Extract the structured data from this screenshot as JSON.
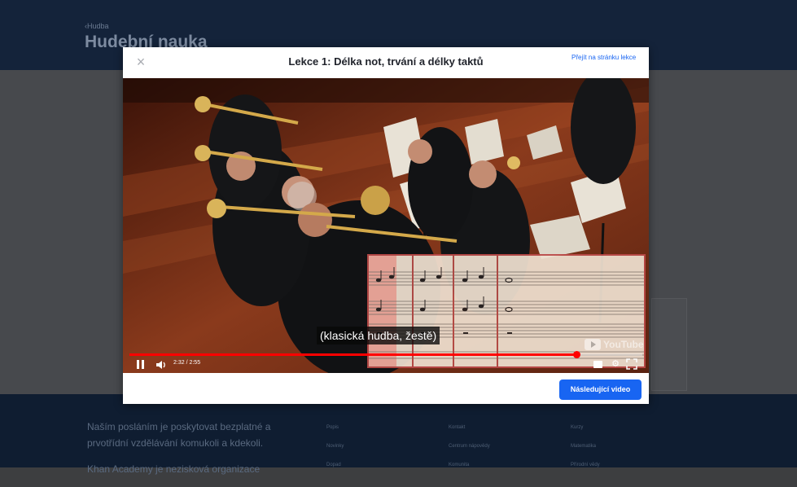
{
  "page": {
    "breadcrumb": "‹Hudba",
    "title": "Hudební nauka"
  },
  "footer": {
    "mission": [
      "Naším posláním je poskytovat bezplatné a prvotřídní vzdělávání komukoli a kdekoli.",
      "Khan Academy je nezisková organizace"
    ],
    "col1": [
      "Popis",
      "Novinky",
      "Dopad"
    ],
    "col2": [
      "Kontakt",
      "Centrum nápovědy",
      "Komunita"
    ],
    "col3": [
      "Kurzy",
      "Matematika",
      "Přírodní vědy"
    ]
  },
  "modal": {
    "close_label": "×",
    "title": "Lekce 1: Délka not, trvání a délky taktů",
    "lesson_link": "Přejít na stránku lekce",
    "next_button": "Následující video"
  },
  "video": {
    "subtitle": "(klasická hudba, žestě)",
    "time": "2:32 / 2:55",
    "progress_fraction": 0.872,
    "brand": "YouTube",
    "progress_color": "#ff0000"
  },
  "colors": {
    "accent": "#1865f2",
    "header_bg": "#14233a",
    "footer_bg": "#0f1d31"
  }
}
